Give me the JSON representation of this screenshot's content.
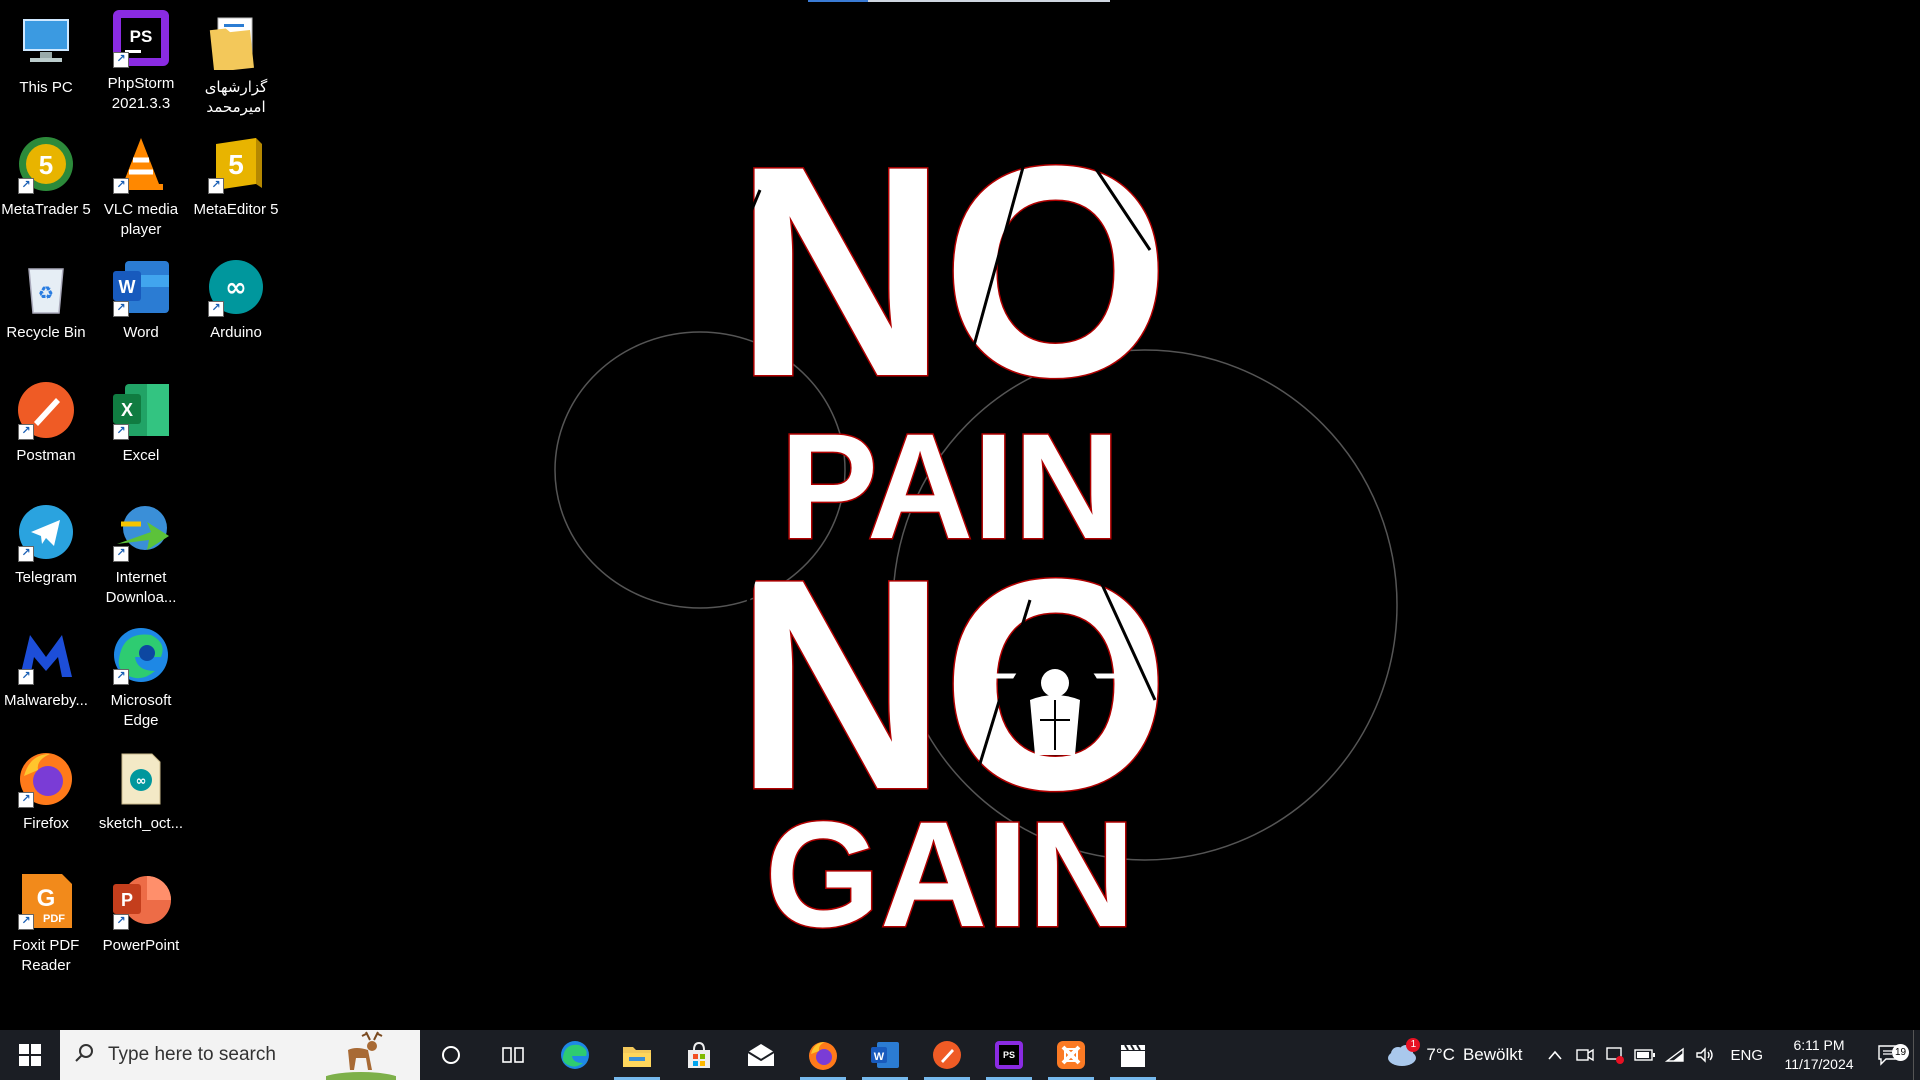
{
  "wallpaper": {
    "line1": "NO",
    "line2": "PAIN",
    "line3": "NO",
    "line4": "GAIN"
  },
  "desktop_icons": [
    {
      "label": "This PC",
      "icon": "computer-icon"
    },
    {
      "label": "PhpStorm 2021.3.3",
      "icon": "phpstorm-icon"
    },
    {
      "label": "گزارشهای امیرمحمد",
      "icon": "folder-icon"
    },
    {
      "label": "MetaTrader 5",
      "icon": "metatrader-icon"
    },
    {
      "label": "VLC media player",
      "icon": "vlc-icon"
    },
    {
      "label": "MetaEditor 5",
      "icon": "metaeditor-icon"
    },
    {
      "label": "Recycle Bin",
      "icon": "recycle-bin-icon"
    },
    {
      "label": "Word",
      "icon": "word-icon"
    },
    {
      "label": "Arduino",
      "icon": "arduino-icon"
    },
    {
      "label": "Postman",
      "icon": "postman-icon"
    },
    {
      "label": "Excel",
      "icon": "excel-icon"
    },
    {
      "label": "Telegram",
      "icon": "telegram-icon"
    },
    {
      "label": "Internet Downloa...",
      "icon": "internet-download-manager-icon"
    },
    {
      "label": "Malwareby...",
      "icon": "malwarebytes-icon"
    },
    {
      "label": "Microsoft Edge",
      "icon": "edge-icon"
    },
    {
      "label": "Firefox",
      "icon": "firefox-icon"
    },
    {
      "label": "sketch_oct...",
      "icon": "arduino-sketch-icon"
    },
    {
      "label": "Foxit PDF Reader",
      "icon": "foxit-pdf-icon"
    },
    {
      "label": "PowerPoint",
      "icon": "powerpoint-icon"
    }
  ],
  "taskbar": {
    "search_placeholder": "Type here to search",
    "pinned": [
      "cortana-icon",
      "task-view-icon",
      "edge-icon",
      "file-explorer-icon",
      "microsoft-store-icon",
      "mail-icon",
      "firefox-icon",
      "word-icon",
      "postman-icon",
      "phpstorm-icon",
      "xampp-icon",
      "clapper-icon"
    ],
    "weather": {
      "temp": "7°C",
      "condition": "Bewölkt",
      "badge": "1"
    },
    "language": "ENG",
    "time": "6:11 PM",
    "date": "11/17/2024",
    "notification_count": "19"
  },
  "colors": {
    "taskbar_bg": "#1b1e24",
    "accent": "#76b9ed",
    "wallpaper_text": "#ffffff",
    "wallpaper_outline": "#b00000"
  }
}
